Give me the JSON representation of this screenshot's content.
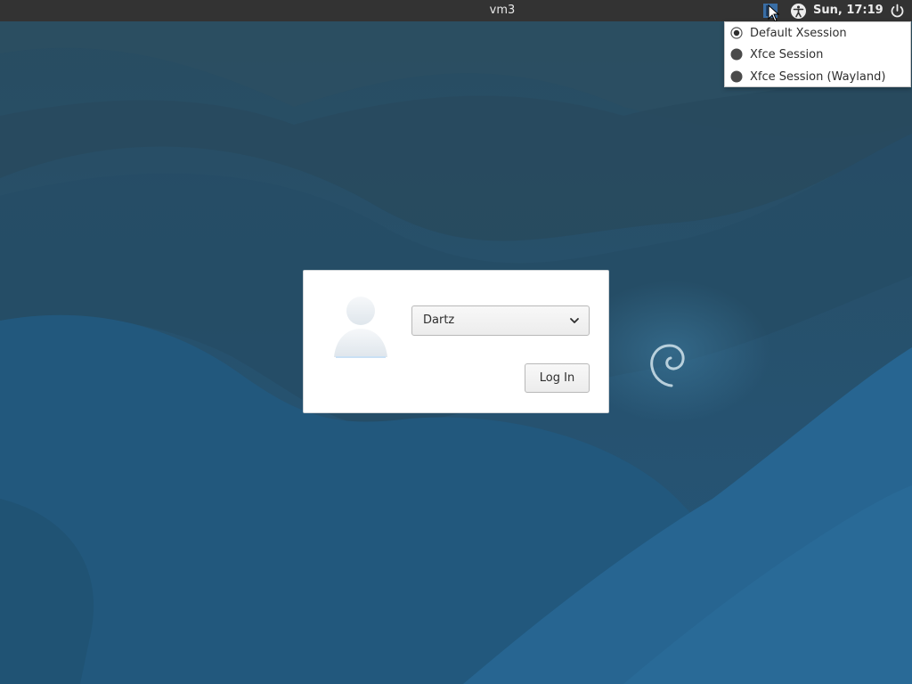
{
  "top_panel": {
    "hostname": "vm3",
    "clock": "Sun, 17:19",
    "icons": {
      "session": "session-indicator-icon",
      "accessibility": "accessibility-icon",
      "power": "power-icon"
    }
  },
  "session_menu": {
    "items": [
      {
        "label": "Default Xsession",
        "selected": true
      },
      {
        "label": "Xfce Session",
        "selected": false
      },
      {
        "label": "Xfce Session (Wayland)",
        "selected": false
      }
    ]
  },
  "login": {
    "selected_user": "Dartz",
    "login_label": "Log In",
    "avatar_icon": "user-avatar-icon"
  },
  "colors": {
    "panel_bg": "#333333",
    "wallpaper_base": "#23506f",
    "accent": "#3a6ea5"
  }
}
